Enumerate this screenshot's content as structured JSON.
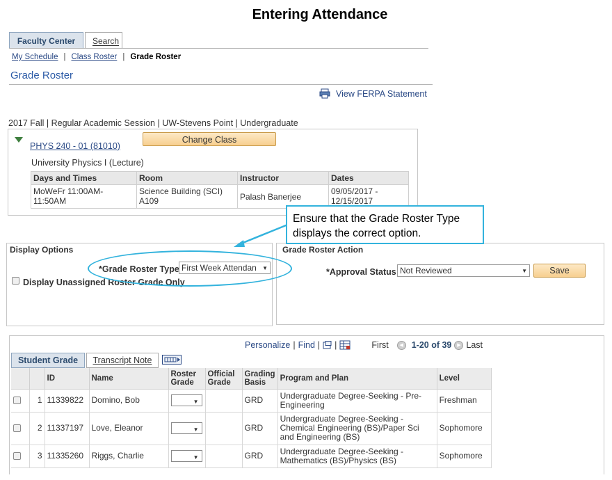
{
  "doc_title": "Entering Attendance",
  "top_tabs": {
    "faculty_center": "Faculty Center",
    "search": "Search"
  },
  "subnav": {
    "my_schedule": "My Schedule",
    "class_roster": "Class Roster",
    "grade_roster": "Grade Roster",
    "separator": "|"
  },
  "page_title": "Grade Roster",
  "ferpa_link": "View FERPA Statement",
  "term": "2017 Fall | Regular Academic Session | UW-Stevens Point | Undergraduate",
  "class": {
    "link": "PHYS 240 - 01 (81010)",
    "change_button": "Change Class",
    "description": "University Physics I (Lecture)",
    "meeting_headers": [
      "Days and Times",
      "Room",
      "Instructor",
      "Dates"
    ],
    "meeting_row": [
      "MoWeFr 11:00AM-11:50AM",
      "Science Building (SCI) A109",
      "Palash Banerjee",
      "09/05/2017 - 12/15/2017"
    ]
  },
  "callout": "Ensure that the Grade Roster Type displays the correct option.",
  "display_options": {
    "heading": "Display Options",
    "roster_type_label": "*Grade Roster Type",
    "roster_type_value": "First Week Attendan",
    "unassigned_label": "Display Unassigned Roster Grade Only"
  },
  "action": {
    "heading": "Grade Roster Action",
    "approval_label": "*Approval Status",
    "approval_value": "Not Reviewed",
    "save_button": "Save"
  },
  "grid_nav": {
    "personalize": "Personalize",
    "find": "Find",
    "sep": "|",
    "first": "First",
    "range": "1-20 of 39",
    "last": "Last"
  },
  "grid_tabs": {
    "student_grade": "Student Grade",
    "transcript_note": "Transcript Note"
  },
  "grid_headers": [
    "",
    "",
    "ID",
    "Name",
    "Roster Grade",
    "Official Grade",
    "Grading Basis",
    "Program and Plan",
    "Level"
  ],
  "students": [
    {
      "num": "1",
      "id": "11339822",
      "name": "Domino, Bob",
      "basis": "GRD",
      "program": "Undergraduate Degree-Seeking - Pre-Engineering",
      "level": "Freshman"
    },
    {
      "num": "2",
      "id": "11337197",
      "name": "Love, Eleanor",
      "basis": "GRD",
      "program": "Undergraduate Degree-Seeking - Chemical Engineering (BS)/Paper Sci and Engineering (BS)",
      "level": "Sophomore"
    },
    {
      "num": "3",
      "id": "11335260",
      "name": "Riggs, Charlie",
      "basis": "GRD",
      "program": "Undergraduate Degree-Seeking - Mathematics (BS)/Physics (BS)",
      "level": "Sophomore"
    }
  ],
  "colors": {
    "accent_blue": "#33b3dd",
    "link": "#2b4a86",
    "button": "#f7cf8f"
  }
}
